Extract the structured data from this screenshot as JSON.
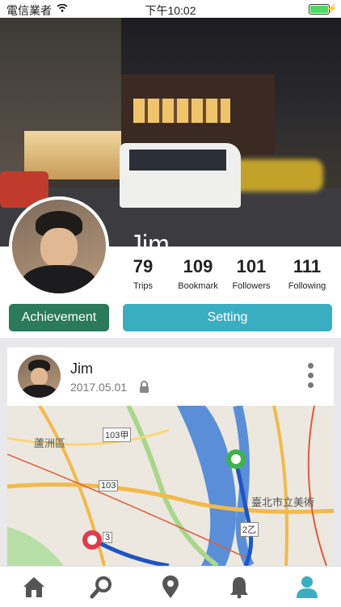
{
  "status": {
    "carrier": "電信業者",
    "time": "下午10:02"
  },
  "profile": {
    "name": "Jim",
    "stats": [
      {
        "value": "79",
        "label": "Trips"
      },
      {
        "value": "109",
        "label": "Bookmark"
      },
      {
        "value": "101",
        "label": "Followers"
      },
      {
        "value": "111",
        "label": "Following"
      }
    ],
    "achievement_label": "Achievement",
    "setting_label": "Setting"
  },
  "trip": {
    "user": "Jim",
    "date": "2017.05.01",
    "map_labels": {
      "district": "蘆洲區",
      "museum": "臺北市立美術",
      "r1": "103甲",
      "r2": "103",
      "r3": "2乙",
      "r4": "3"
    }
  },
  "colors": {
    "achievement": "#2a7a5b",
    "setting": "#3aaec1",
    "tab_active": "#3aaec1",
    "tab_inactive": "#555555"
  },
  "tabs": [
    "home-icon",
    "search-icon",
    "location-icon",
    "notification-icon",
    "profile-icon"
  ]
}
